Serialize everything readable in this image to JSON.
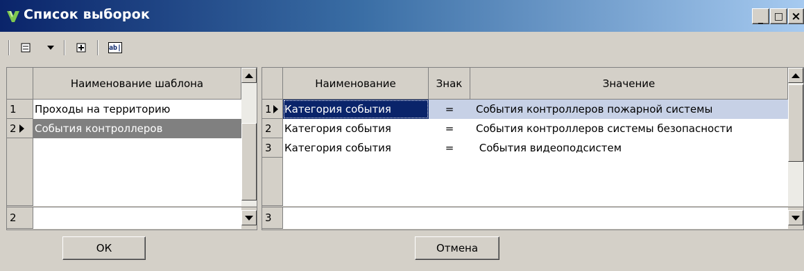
{
  "window": {
    "title": "Список выборок",
    "minimize_label": "_",
    "maximize_label": "□",
    "close_label": "×",
    "title_gradient_start": "#0a246a",
    "title_gradient_end": "#a6caf0"
  },
  "toolbar": {
    "icons": [
      "delete-row-icon",
      "dropdown-icon",
      "add-row-icon",
      "rename-icon"
    ],
    "rename_glyph": "ab|"
  },
  "templates": {
    "header": "Наименование шаблона",
    "rows": [
      {
        "index": "1",
        "name": "Проходы на территорию",
        "selected": false
      },
      {
        "index": "2",
        "name": "События контроллеров",
        "selected": true
      }
    ],
    "footer_index": "2"
  },
  "conditions": {
    "headers": {
      "name": "Наименование",
      "sign": "Знак",
      "value": "Значение"
    },
    "rows": [
      {
        "index": "1",
        "name": "Категория события",
        "sign": "=",
        "value": "События контроллеров пожарной системы",
        "selected": true
      },
      {
        "index": "2",
        "name": "Категория события",
        "sign": "=",
        "value": "События контроллеров системы безопасности",
        "selected": false
      },
      {
        "index": "3",
        "name": "Категория события",
        "sign": "=",
        "value": " События видеоподсистем",
        "selected": false
      }
    ],
    "footer_index": "3"
  },
  "buttons": {
    "ok": "ОК",
    "cancel": "Отмена"
  },
  "colors": {
    "selected_row": "#808080",
    "highlight_row": "#c7d1e6",
    "selected_cell": "#0a246a"
  }
}
